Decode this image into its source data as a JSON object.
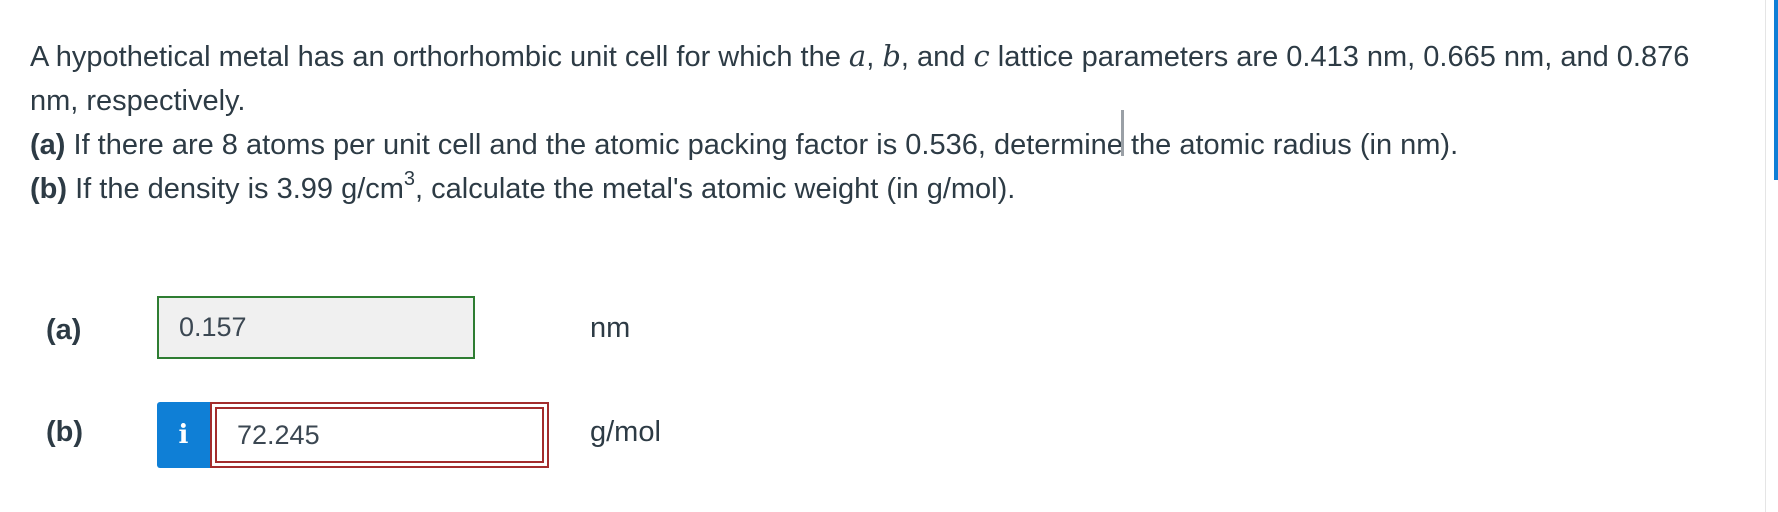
{
  "question": {
    "intro_pre": "A hypothetical metal has an orthorhombic unit cell for which the ",
    "var_a": "a",
    "sep1": ", ",
    "var_b": "b",
    "sep2": ", and ",
    "var_c": "c",
    "intro_post": " lattice parameters are 0.413 nm, 0.665 nm, and 0.876 nm, respectively.",
    "part_a_label": "(a)",
    "part_a_text": " If there are 8 atoms per unit cell and the atomic packing factor is 0.536, determine the atomic radius (in nm).",
    "part_b_label": "(b)",
    "part_b_text_pre": " If the density is 3.99 g/cm",
    "part_b_sup": "3",
    "part_b_text_post": ", calculate the metal's atomic weight (in g/mol)."
  },
  "answers": {
    "a": {
      "label": "(a)",
      "value": "0.157",
      "unit": "nm",
      "status_color": "#2e7d32"
    },
    "b": {
      "label": "(b)",
      "info_icon": "i",
      "value": "72.245",
      "unit": "g/mol",
      "status_color": "#a32c2c"
    }
  },
  "colors": {
    "accent": "#0f7fd6",
    "text": "#2d3b45"
  }
}
